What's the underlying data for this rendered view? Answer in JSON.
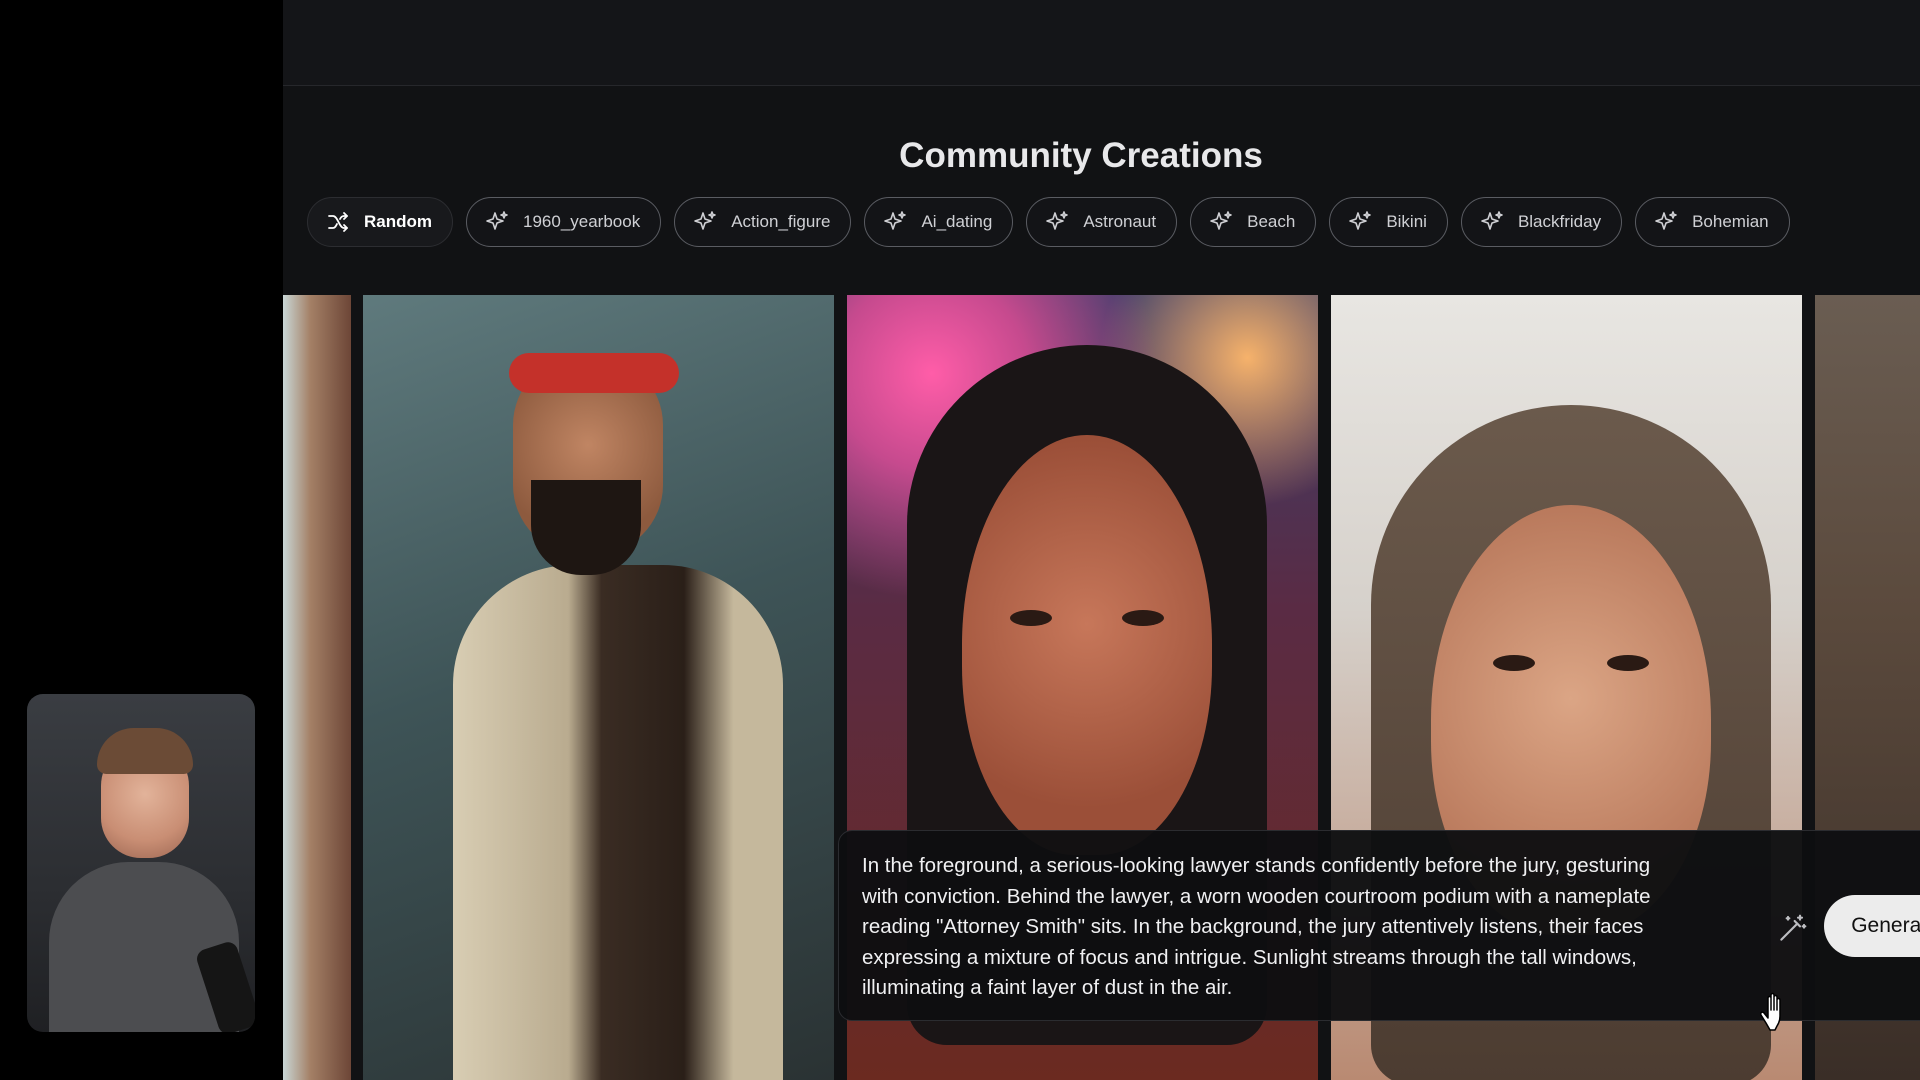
{
  "page": {
    "title": "Community Creations"
  },
  "filters": [
    {
      "label": "Random",
      "icon": "shuffle-icon",
      "active": true
    },
    {
      "label": "1960_yearbook",
      "icon": "sparkle-icon",
      "active": false
    },
    {
      "label": "Action_figure",
      "icon": "sparkle-icon",
      "active": false
    },
    {
      "label": "Ai_dating",
      "icon": "sparkle-icon",
      "active": false
    },
    {
      "label": "Astronaut",
      "icon": "sparkle-icon",
      "active": false
    },
    {
      "label": "Beach",
      "icon": "sparkle-icon",
      "active": false
    },
    {
      "label": "Bikini",
      "icon": "sparkle-icon",
      "active": false
    },
    {
      "label": "Blackfriday",
      "icon": "sparkle-icon",
      "active": false
    },
    {
      "label": "Bohemian",
      "icon": "sparkle-icon",
      "active": false
    }
  ],
  "prompt": {
    "text": "In the foreground, a serious-looking lawyer stands confidently before the jury, gesturing\nwith conviction. Behind the lawyer, a worn wooden courtroom podium with a nameplate\nreading \"Attorney Smith\" sits. In the background, the jury attentively listens, their faces\nexpressing a mixture of focus and  intrigue. Sunlight streams through the tall windows,\nilluminating a faint layer of dust in the air.",
    "enhance_icon": "magic-wand-icon",
    "generate_label": "Generate"
  },
  "colors": {
    "background": "#111214",
    "chip_border": "#5a5c62",
    "button_bg": "#ececec"
  }
}
